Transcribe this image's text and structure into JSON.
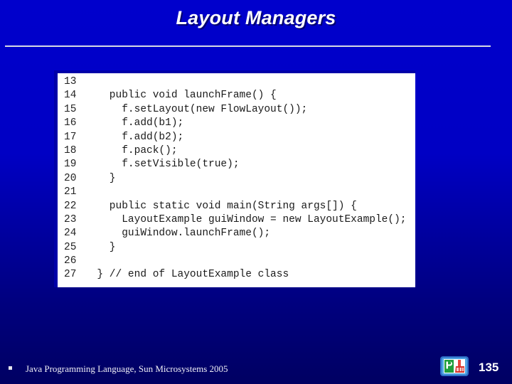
{
  "slide": {
    "title": "Layout Managers",
    "background_top_color": "#0000CC",
    "background_bottom_color": "#000062",
    "divider_color": "#C8CCD8",
    "title_color": "#FFFFFF"
  },
  "code_block": {
    "border_color": "#0000A8",
    "background_color": "#FFFFFF",
    "text_color": "#1A1A1A",
    "lines": [
      {
        "number": "13",
        "text": ""
      },
      {
        "number": "14",
        "text": "    public void launchFrame() {"
      },
      {
        "number": "15",
        "text": "      f.setLayout(new FlowLayout());"
      },
      {
        "number": "16",
        "text": "      f.add(b1);"
      },
      {
        "number": "17",
        "text": "      f.add(b2);"
      },
      {
        "number": "18",
        "text": "      f.pack();"
      },
      {
        "number": "19",
        "text": "      f.setVisible(true);"
      },
      {
        "number": "20",
        "text": "    }"
      },
      {
        "number": "21",
        "text": ""
      },
      {
        "number": "22",
        "text": "    public static void main(String args[]) {"
      },
      {
        "number": "23",
        "text": "      LayoutExample guiWindow = new LayoutExample();"
      },
      {
        "number": "24",
        "text": "      guiWindow.launchFrame();"
      },
      {
        "number": "25",
        "text": "    }"
      },
      {
        "number": "26",
        "text": ""
      },
      {
        "number": "27",
        "text": "  } // end of LayoutExample class"
      }
    ]
  },
  "footer": {
    "bullet": "▪",
    "text": "Java Programming Language, Sun Microsystems 2005",
    "page_number": "135",
    "logo_name": "sun-java-logo"
  }
}
